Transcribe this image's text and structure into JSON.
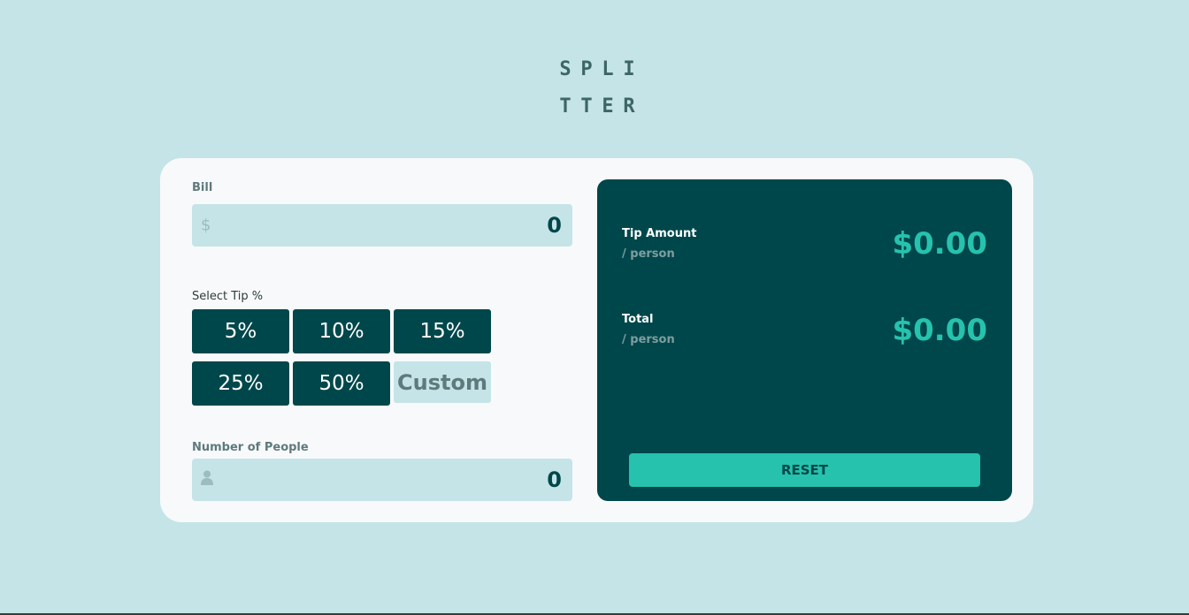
{
  "logo": {
    "line1": [
      "S",
      "P",
      "L",
      "I"
    ],
    "line2": [
      "T",
      "T",
      "E",
      "R"
    ]
  },
  "bill": {
    "label": "Bill",
    "icon": "dollar-icon",
    "icon_glyph": "$",
    "value": "0"
  },
  "tip": {
    "label": "Select Tip %",
    "options": [
      "5%",
      "10%",
      "15%",
      "25%",
      "50%"
    ],
    "custom_placeholder": "Custom"
  },
  "people": {
    "label": "Number of People",
    "icon": "person-icon",
    "value": "0"
  },
  "results": {
    "tip_amount": {
      "title": "Tip Amount",
      "sub": "/ person",
      "value": "$0.00"
    },
    "total": {
      "title": "Total",
      "sub": "/ person",
      "value": "$0.00"
    },
    "reset_label": "RESET"
  },
  "colors": {
    "background": "#c5e4e7",
    "dark": "#00474b",
    "accent": "#26c2ad",
    "card": "#f8f9fb"
  }
}
